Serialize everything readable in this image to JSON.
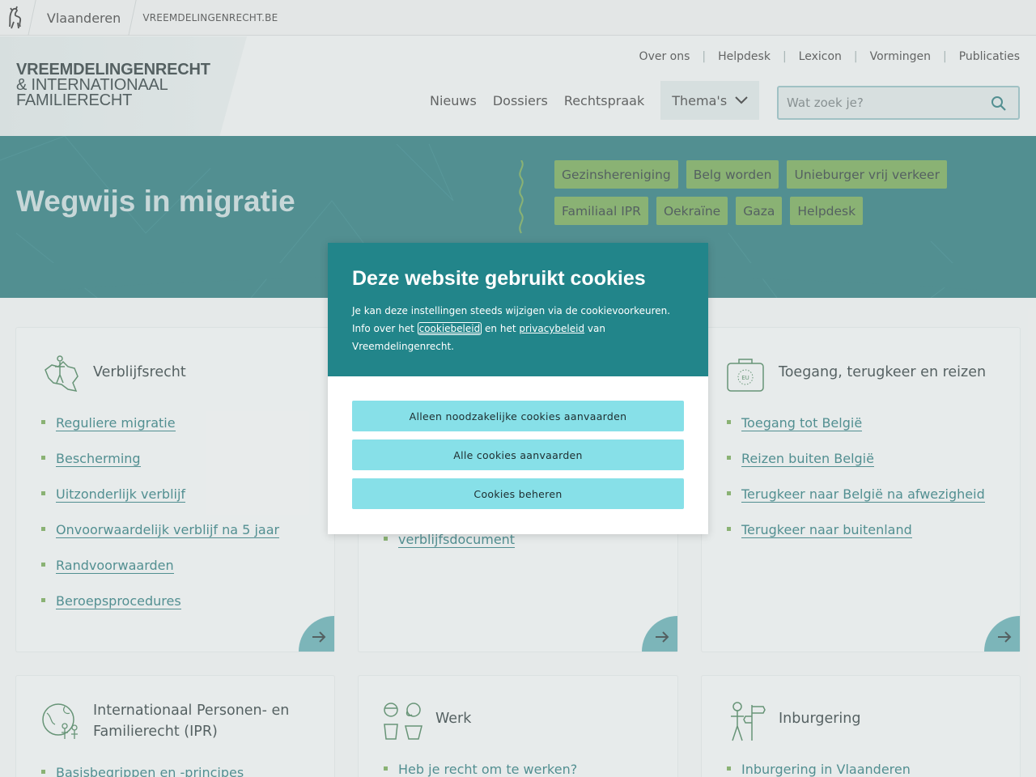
{
  "topbar": {
    "brand": "Vlaanderen",
    "site": "VREEMDELINGENRECHT.BE"
  },
  "logo": {
    "line1": "VREEMDELINGENRECHT",
    "line2": "& INTERNATIONAAL",
    "line3": "FAMILIERECHT"
  },
  "utilnav": [
    "Over ons",
    "Helpdesk",
    "Lexicon",
    "Vormingen",
    "Publicaties"
  ],
  "mainnav": {
    "items": [
      "Nieuws",
      "Dossiers",
      "Rechtspraak"
    ],
    "themas": "Thema's"
  },
  "search": {
    "placeholder": "Wat zoek je?"
  },
  "hero": {
    "title": "Wegwijs in migratie",
    "tags": [
      "Gezinshereniging",
      "Belg worden",
      "Unieburger vrij verkeer",
      "Familiaal IPR",
      "Oekraïne",
      "Gaza",
      "Helpdesk"
    ]
  },
  "cards": {
    "verblijf": {
      "title": "Verblijfsrecht",
      "links": [
        "Reguliere migratie",
        "Bescherming",
        "Uitzonderlijk verblijf",
        "Onvoorwaardelijk verblijf na 5 jaar",
        "Randvoorwaarden",
        "Beroepsprocedures"
      ]
    },
    "middle": {
      "link_fragment": "verblijfsdocument"
    },
    "toegang": {
      "title": "Toegang, terugkeer en reizen",
      "links": [
        "Toegang tot België",
        "Reizen buiten België",
        "Terugkeer naar België na afwezigheid",
        "Terugkeer naar buitenland"
      ]
    },
    "ipr": {
      "title_line1": "Internationaal Personen- en",
      "title_line2": "Familierecht (IPR)",
      "first_link": "Basisbegrippen en -principes"
    },
    "werk": {
      "title": "Werk",
      "first_link": "Heb je recht om te werken?"
    },
    "inburgering": {
      "title": "Inburgering",
      "first_link": "Inburgering in Vlaanderen"
    }
  },
  "cookie_modal": {
    "title": "Deze website gebruikt cookies",
    "text1": "Je kan deze instellingen steeds wijzigen via de cookievoorkeuren.",
    "text2_pre": "Info over het ",
    "link_cookiebeleid": "cookiebeleid",
    "text2_mid": " en het ",
    "link_privacybeleid": "privacybeleid",
    "text2_post": " van",
    "text3": "Vreemdelingenrecht.",
    "buttons": [
      "Alleen noodzakelijke cookies aanvaarden",
      "Alle cookies aanvaarden",
      "Cookies beheren"
    ]
  },
  "colors": {
    "teal": "#1b7275",
    "green": "#6ea64a",
    "button_cyan": "#87e0e8",
    "modal_head": "#22858a"
  }
}
